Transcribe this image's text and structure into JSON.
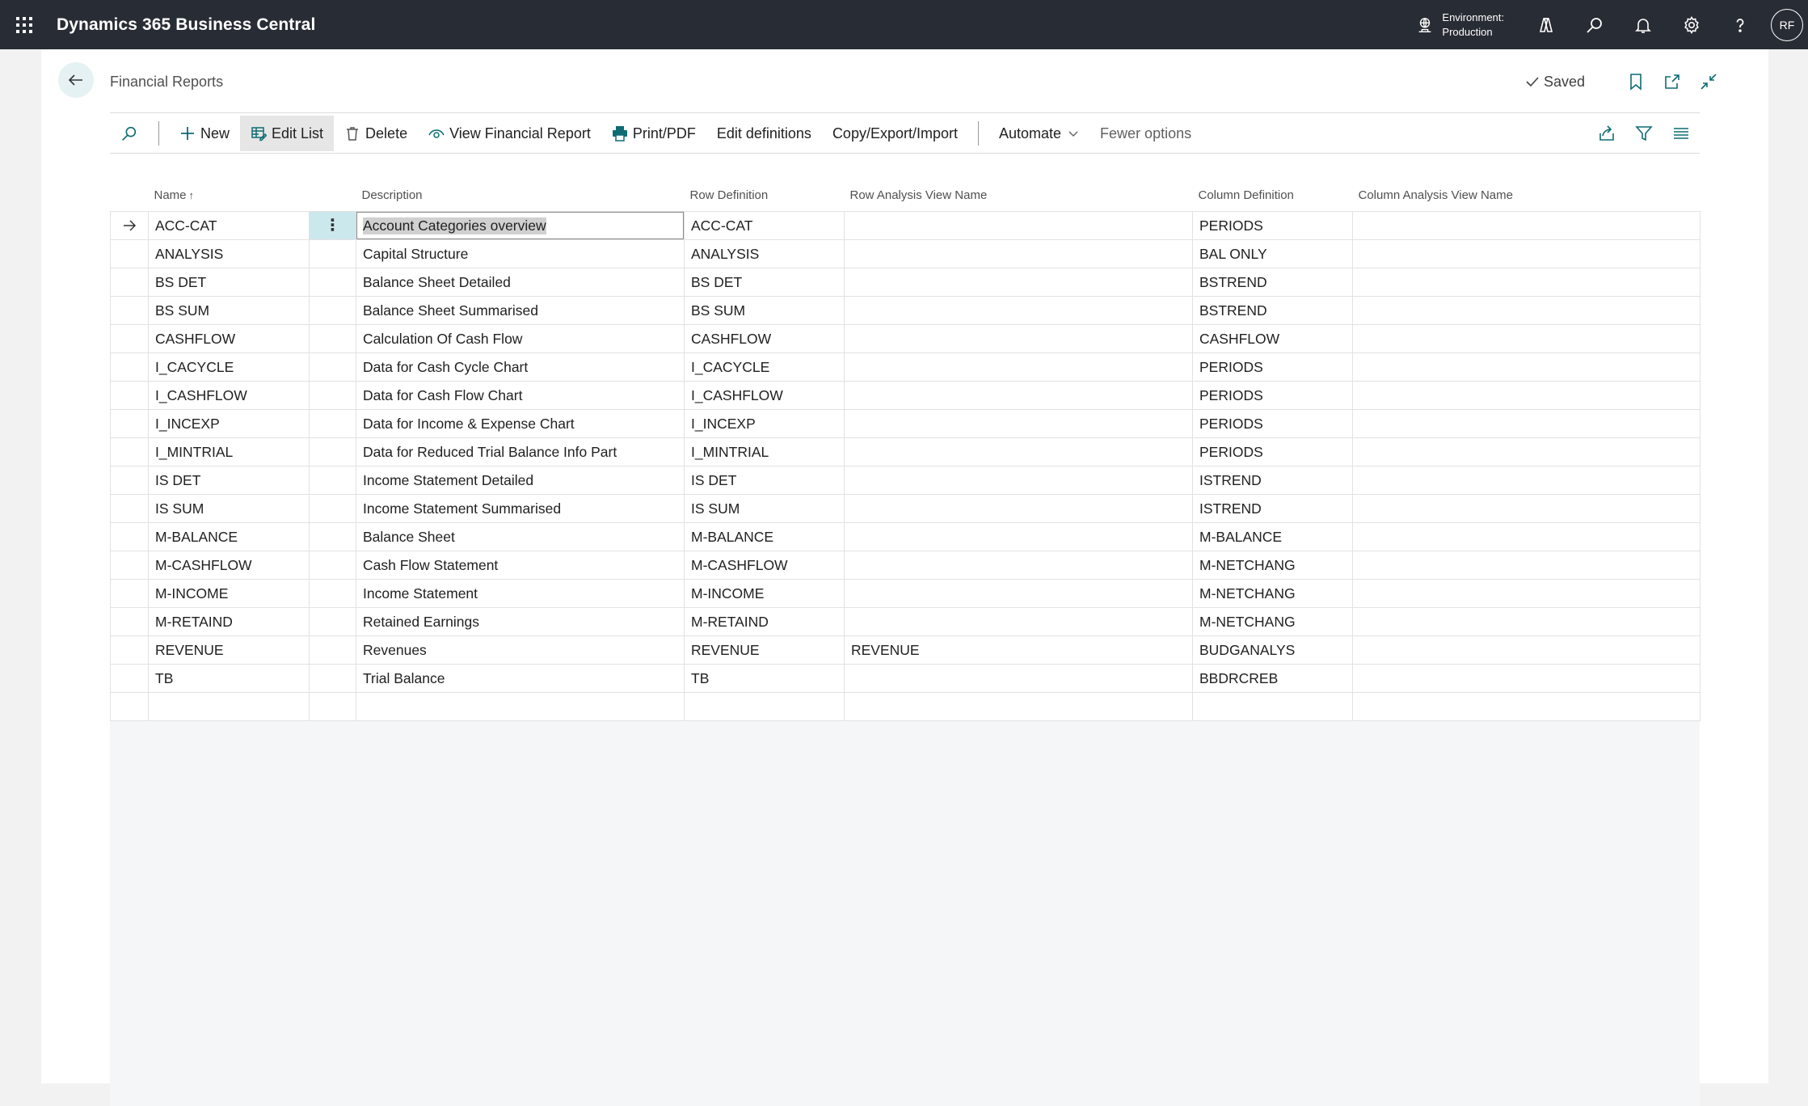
{
  "app": {
    "title": "Dynamics 365 Business Central",
    "environment_label": "Environment:",
    "environment_value": "Production",
    "avatar_initials": "RF"
  },
  "page": {
    "title": "Financial Reports",
    "saved_label": "Saved"
  },
  "actions": {
    "new": "New",
    "edit_list": "Edit List",
    "delete": "Delete",
    "view_report": "View Financial Report",
    "print": "Print/PDF",
    "edit_definitions": "Edit definitions",
    "copy_export_import": "Copy/Export/Import",
    "automate": "Automate",
    "fewer_options": "Fewer options"
  },
  "columns": {
    "name": "Name",
    "name_sort": "↑",
    "description": "Description",
    "row_definition": "Row Definition",
    "row_analysis_view": "Row Analysis View Name",
    "column_definition": "Column Definition",
    "column_analysis_view": "Column Analysis View Name"
  },
  "rows": [
    {
      "name": "ACC-CAT",
      "description": "Account Categories overview",
      "row_def": "ACC-CAT",
      "row_view": "",
      "col_def": "PERIODS",
      "col_view": ""
    },
    {
      "name": "ANALYSIS",
      "description": "Capital Structure",
      "row_def": "ANALYSIS",
      "row_view": "",
      "col_def": "BAL ONLY",
      "col_view": ""
    },
    {
      "name": "BS DET",
      "description": "Balance Sheet Detailed",
      "row_def": "BS DET",
      "row_view": "",
      "col_def": "BSTREND",
      "col_view": ""
    },
    {
      "name": "BS SUM",
      "description": "Balance Sheet Summarised",
      "row_def": "BS SUM",
      "row_view": "",
      "col_def": "BSTREND",
      "col_view": ""
    },
    {
      "name": "CASHFLOW",
      "description": "Calculation Of Cash Flow",
      "row_def": "CASHFLOW",
      "row_view": "",
      "col_def": "CASHFLOW",
      "col_view": ""
    },
    {
      "name": "I_CACYCLE",
      "description": "Data for Cash Cycle Chart",
      "row_def": "I_CACYCLE",
      "row_view": "",
      "col_def": "PERIODS",
      "col_view": ""
    },
    {
      "name": "I_CASHFLOW",
      "description": "Data for Cash Flow Chart",
      "row_def": "I_CASHFLOW",
      "row_view": "",
      "col_def": "PERIODS",
      "col_view": ""
    },
    {
      "name": "I_INCEXP",
      "description": "Data for Income & Expense Chart",
      "row_def": "I_INCEXP",
      "row_view": "",
      "col_def": "PERIODS",
      "col_view": ""
    },
    {
      "name": "I_MINTRIAL",
      "description": "Data for Reduced Trial Balance Info Part",
      "row_def": "I_MINTRIAL",
      "row_view": "",
      "col_def": "PERIODS",
      "col_view": ""
    },
    {
      "name": "IS DET",
      "description": "Income Statement Detailed",
      "row_def": "IS DET",
      "row_view": "",
      "col_def": "ISTREND",
      "col_view": ""
    },
    {
      "name": "IS SUM",
      "description": "Income Statement Summarised",
      "row_def": "IS SUM",
      "row_view": "",
      "col_def": "ISTREND",
      "col_view": ""
    },
    {
      "name": "M-BALANCE",
      "description": "Balance Sheet",
      "row_def": "M-BALANCE",
      "row_view": "",
      "col_def": "M-BALANCE",
      "col_view": ""
    },
    {
      "name": "M-CASHFLOW",
      "description": "Cash Flow Statement",
      "row_def": "M-CASHFLOW",
      "row_view": "",
      "col_def": "M-NETCHANG",
      "col_view": ""
    },
    {
      "name": "M-INCOME",
      "description": "Income Statement",
      "row_def": "M-INCOME",
      "row_view": "",
      "col_def": "M-NETCHANG",
      "col_view": ""
    },
    {
      "name": "M-RETAIND",
      "description": "Retained Earnings",
      "row_def": "M-RETAIND",
      "row_view": "",
      "col_def": "M-NETCHANG",
      "col_view": ""
    },
    {
      "name": "REVENUE",
      "description": "Revenues",
      "row_def": "REVENUE",
      "row_view": "REVENUE",
      "col_def": "BUDGANALYS",
      "col_view": ""
    },
    {
      "name": "TB",
      "description": "Trial Balance",
      "row_def": "TB",
      "row_view": "",
      "col_def": "BBDRCREB",
      "col_view": ""
    },
    {
      "name": "",
      "description": "",
      "row_def": "",
      "row_view": "",
      "col_def": "",
      "col_view": ""
    }
  ],
  "colors": {
    "topbar": "#282c34",
    "accent": "#008489",
    "selection": "#cbe8ec"
  }
}
